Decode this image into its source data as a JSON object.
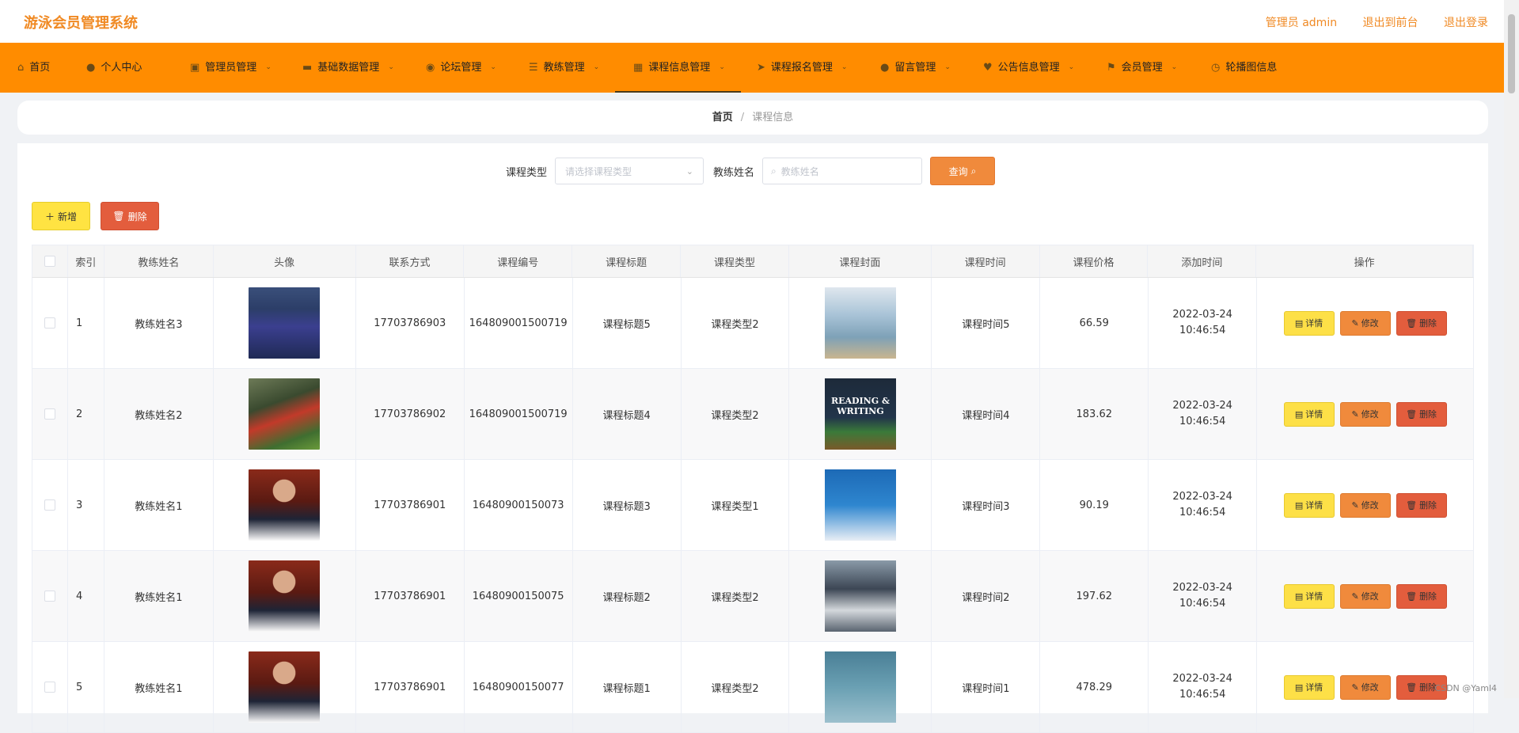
{
  "app": {
    "title": "游泳会员管理系统",
    "user_label": "管理员 admin",
    "front_link": "退出到前台",
    "logout_link": "退出登录"
  },
  "nav": [
    {
      "label": "首页",
      "icon": "home-icon"
    },
    {
      "label": "个人中心",
      "icon": "user-icon"
    },
    {
      "label": "管理员管理",
      "icon": "building-icon"
    },
    {
      "label": "基础数据管理",
      "icon": "bed-icon"
    },
    {
      "label": "论坛管理",
      "icon": "database-icon"
    },
    {
      "label": "教练管理",
      "icon": "list-icon"
    },
    {
      "label": "课程信息管理",
      "icon": "grid-icon"
    },
    {
      "label": "课程报名管理",
      "icon": "send-icon"
    },
    {
      "label": "留言管理",
      "icon": "person-icon"
    },
    {
      "label": "公告信息管理",
      "icon": "award-icon"
    },
    {
      "label": "会员管理",
      "icon": "flag-icon"
    },
    {
      "label": "轮播图信息",
      "icon": "clock-icon"
    }
  ],
  "breadcrumb": {
    "home": "首页",
    "sep": "/",
    "current": "课程信息"
  },
  "search": {
    "type_label": "课程类型",
    "type_placeholder": "请选择课程类型",
    "coach_label": "教练姓名",
    "coach_placeholder": "教练姓名",
    "query_button": "查询"
  },
  "actions": {
    "add": "新增",
    "delete": "删除"
  },
  "table": {
    "headers": [
      "索引",
      "教练姓名",
      "头像",
      "联系方式",
      "课程编号",
      "课程标题",
      "课程类型",
      "课程封面",
      "课程时间",
      "课程价格",
      "添加时间",
      "操作"
    ],
    "rows": [
      {
        "index": "1",
        "coach": "教练姓名3",
        "phone": "17703786903",
        "code": "164809001500719",
        "title": "课程标题5",
        "type": "课程类型2",
        "time": "课程时间5",
        "price": "66.59",
        "added": "2022-03-24 10:46:54"
      },
      {
        "index": "2",
        "coach": "教练姓名2",
        "phone": "17703786902",
        "code": "164809001500719",
        "title": "课程标题4",
        "type": "课程类型2",
        "time": "课程时间4",
        "price": "183.62",
        "added": "2022-03-24 10:46:54"
      },
      {
        "index": "3",
        "coach": "教练姓名1",
        "phone": "17703786901",
        "code": "16480900150073",
        "title": "课程标题3",
        "type": "课程类型1",
        "time": "课程时间3",
        "price": "90.19",
        "added": "2022-03-24 10:46:54"
      },
      {
        "index": "4",
        "coach": "教练姓名1",
        "phone": "17703786901",
        "code": "16480900150075",
        "title": "课程标题2",
        "type": "课程类型2",
        "time": "课程时间2",
        "price": "197.62",
        "added": "2022-03-24 10:46:54"
      },
      {
        "index": "5",
        "coach": "教练姓名1",
        "phone": "17703786901",
        "code": "16480900150077",
        "title": "课程标题1",
        "type": "课程类型2",
        "time": "课程时间1",
        "price": "478.29",
        "added": "2022-03-24 10:46:54"
      }
    ],
    "ops": {
      "detail": "详情",
      "edit": "修改",
      "delete": "删除"
    }
  },
  "cover_text": {
    "reading": "READING & WRITING"
  },
  "watermark": "CSDN @Yaml4",
  "colors": {
    "accent": "#ff8c00",
    "title": "#f08a24",
    "detail": "#fde047",
    "edit": "#f08a3c",
    "delete": "#e35d3d"
  }
}
